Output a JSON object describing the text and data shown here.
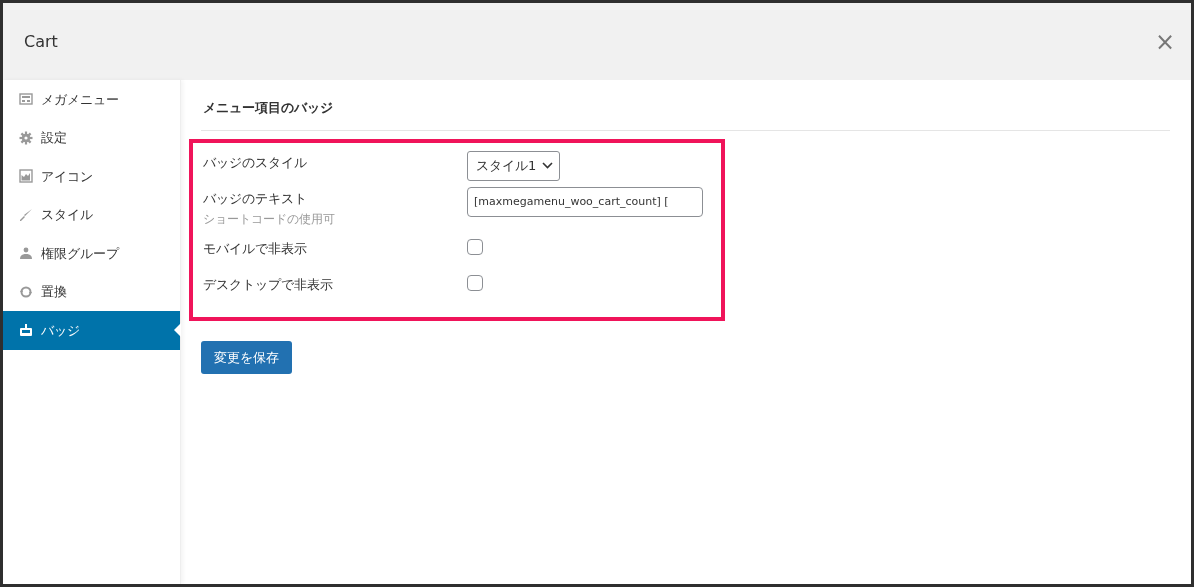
{
  "window": {
    "title": "Cart",
    "close": "×"
  },
  "sidebar": {
    "items": [
      {
        "label": "メガメニュー",
        "selected": false
      },
      {
        "label": "設定",
        "selected": false
      },
      {
        "label": "アイコン",
        "selected": false
      },
      {
        "label": "スタイル",
        "selected": false
      },
      {
        "label": "権限グループ",
        "selected": false
      },
      {
        "label": "置換",
        "selected": false
      },
      {
        "label": "バッジ",
        "selected": true
      }
    ]
  },
  "section": {
    "title": "メニュー項目のバッジ",
    "rows": [
      {
        "kind": "select",
        "label": "バッジのスタイル",
        "value": "スタイル1"
      },
      {
        "kind": "text",
        "label": "バッジのテキスト",
        "hint": "ショートコードの使用可",
        "value": "[maxmegamenu_woo_cart_count] ["
      },
      {
        "kind": "checkbox",
        "label": "モバイルで非表示",
        "checked": false
      },
      {
        "kind": "checkbox",
        "label": "デスクトップで非表示",
        "checked": false
      }
    ]
  },
  "save_button": "変更を保存"
}
